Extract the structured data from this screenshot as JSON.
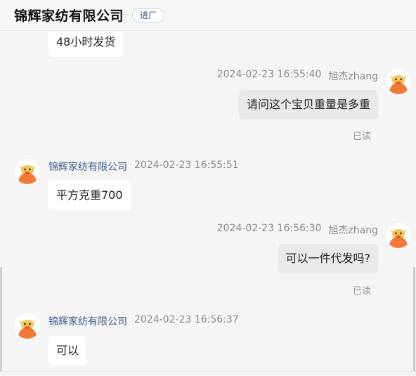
{
  "header": {
    "shop_name": "锦辉家纺有限公司",
    "enter_shop_label": "进厂"
  },
  "messages": [
    {
      "kind": "in",
      "text": "48小时发货"
    },
    {
      "kind": "out",
      "sender": "旭杰zhang",
      "time": "2024-02-23 16:55:40",
      "text": "请问这个宝贝重量是多重",
      "status": "已读"
    },
    {
      "kind": "in",
      "sender": "锦辉家纺有限公司",
      "time": "2024-02-23 16:55:51",
      "text": "平方克重700"
    },
    {
      "kind": "out",
      "sender": "旭杰zhang",
      "time": "2024-02-23 16:56:30",
      "text": "可以一件代发吗?",
      "status": "已读"
    },
    {
      "kind": "in",
      "sender": "锦辉家纺有限公司",
      "time": "2024-02-23 16:56:37",
      "text": "可以"
    }
  ],
  "avatar": {
    "icon": "cow-mascot-icon",
    "face_color": "#f07a3a",
    "horn_color": "#f0c75a"
  }
}
